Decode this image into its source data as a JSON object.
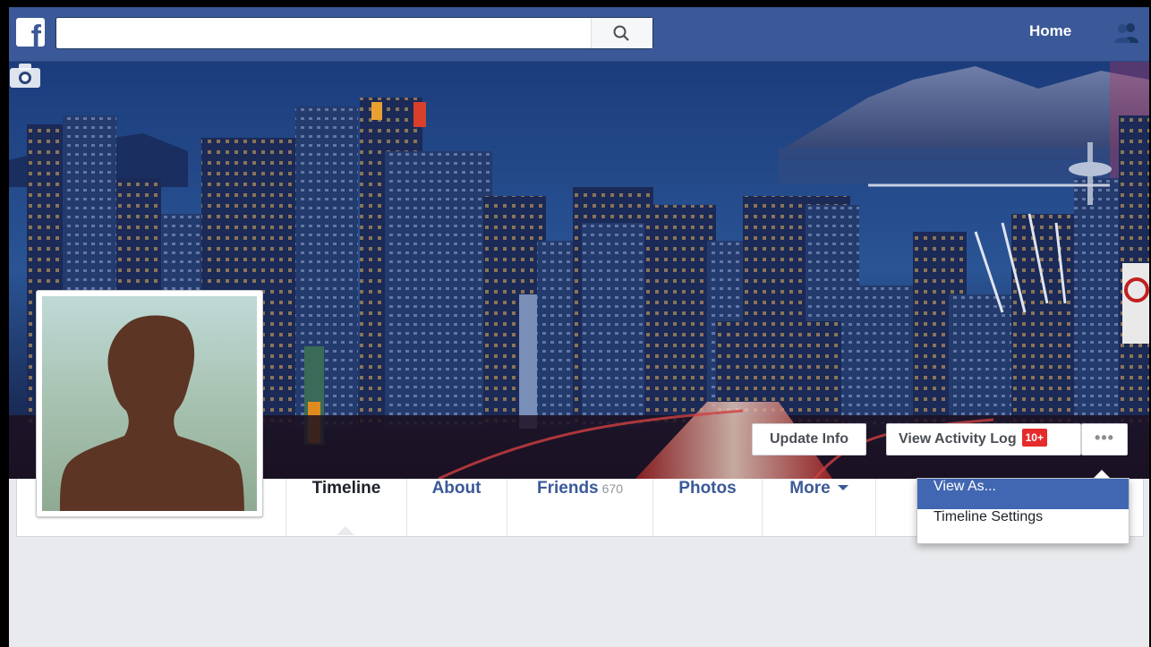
{
  "topbar": {
    "logo_letter": "f",
    "search_placeholder": "",
    "home_label": "Home"
  },
  "cover": {
    "camera_icon": "camera-icon"
  },
  "cover_actions": {
    "update_info": "Update Info",
    "view_activity_log": "View Activity Log",
    "activity_badge": "10+",
    "more_dots": "•••"
  },
  "nav": {
    "tabs": [
      {
        "label": "Timeline"
      },
      {
        "label": "About"
      },
      {
        "label": "Friends",
        "count": "670"
      },
      {
        "label": "Photos"
      },
      {
        "label": "More"
      }
    ]
  },
  "menu": {
    "items": [
      {
        "label": "View As..."
      },
      {
        "label": "Timeline Settings"
      }
    ]
  },
  "colors": {
    "brand": "#3b5998",
    "badge": "#e52b2b",
    "menu_highlight": "#4267b2"
  }
}
